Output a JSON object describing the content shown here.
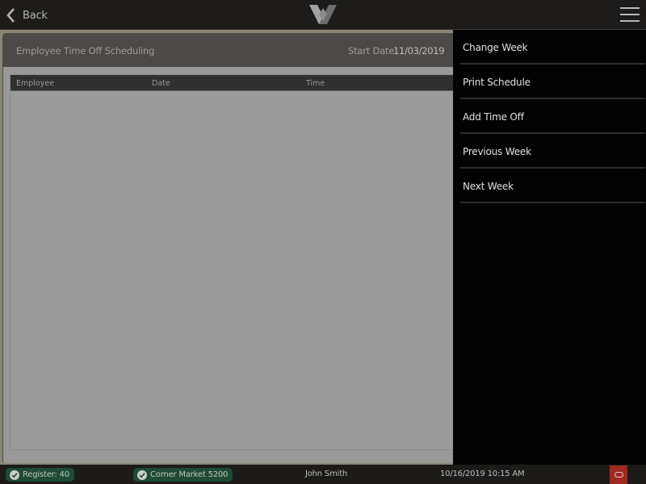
{
  "topbar": {
    "back_label": "Back",
    "logo_icon": "x-logo-icon",
    "menu_icon": "hamburger-icon"
  },
  "panel": {
    "title": "Employee Time Off Scheduling",
    "start_date_label": "Start Date",
    "start_date_value": "11/03/2019",
    "table": {
      "columns": [
        "Employee",
        "Date",
        "Time"
      ],
      "rows": []
    }
  },
  "menu": {
    "items": [
      {
        "label": "Change Week"
      },
      {
        "label": "Print Schedule"
      },
      {
        "label": "Add Time Off"
      },
      {
        "label": "Previous Week"
      },
      {
        "label": "Next Week"
      }
    ]
  },
  "statusbar": {
    "register": "Register: 40",
    "store": "Corner Market 5200",
    "user": "John Smith",
    "datetime": "10/16/2019 10:15 AM"
  },
  "colors": {
    "status_ok": "#1f4a34",
    "oracle_red": "#a0281f",
    "menu_bg": "#020202"
  }
}
